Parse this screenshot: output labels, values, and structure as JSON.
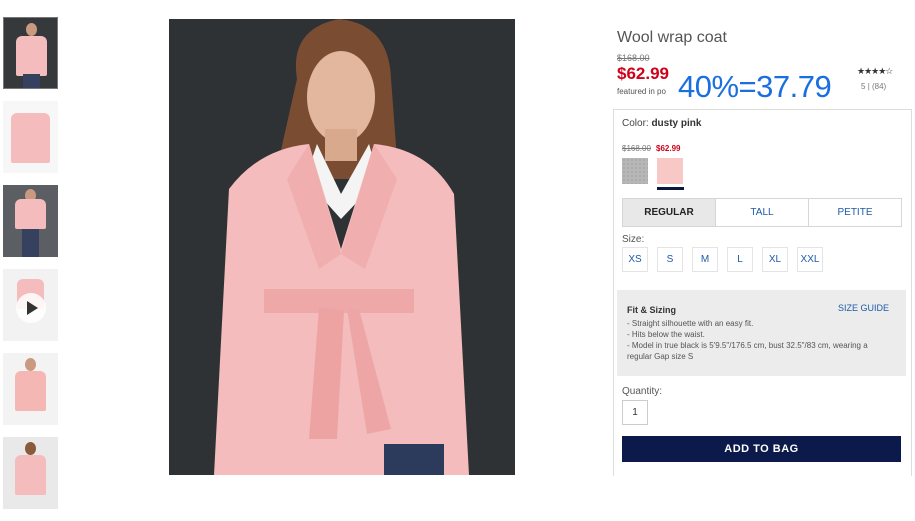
{
  "product": {
    "title": "Wool wrap coat",
    "original_price": "$168.00",
    "sale_price": "$62.99",
    "featured_text": "featured in po",
    "annotation": "40%=37.79",
    "stars": "★★★★☆",
    "rating_score": "5",
    "rating_count": "| (84)"
  },
  "color": {
    "label": "Color: ",
    "value": "dusty pink",
    "swatch_original": "$168.00",
    "swatch_sale": "$62.99",
    "swatches": [
      "grey",
      "dusty pink"
    ]
  },
  "fit_tabs": [
    "REGULAR",
    "TALL",
    "PETITE"
  ],
  "size": {
    "label": "Size:",
    "options": [
      "XS",
      "S",
      "M",
      "L",
      "XL",
      "XXL"
    ]
  },
  "fit_sizing": {
    "title": "Fit & Sizing",
    "guide_link": "SIZE GUIDE",
    "items": [
      "- Straight silhouette with an easy fit.",
      "- Hits below the waist.",
      "- Model in true black is 5'9.5\"/176.5 cm, bust 32.5\"/83 cm, wearing a regular Gap size S"
    ]
  },
  "quantity": {
    "label": "Quantity:",
    "value": "1"
  },
  "add_to_bag": "ADD TO BAG",
  "colors": {
    "sale_red": "#d0021b",
    "link_blue": "#1e5aa8",
    "navy": "#0b1a4a",
    "coat_pink": "#f4bcbc"
  }
}
